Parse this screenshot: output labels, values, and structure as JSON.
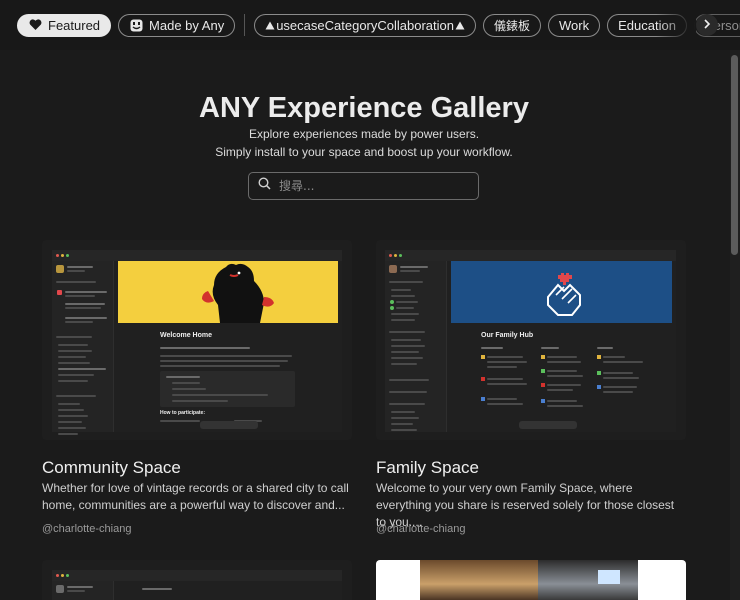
{
  "filters": [
    {
      "label": "Featured",
      "icon": "heart-icon",
      "active": true
    },
    {
      "label": "Made by Any",
      "icon": "any-logo-icon"
    },
    {
      "label": "usecaseCategoryCollaboration"
    },
    {
      "label": "儀錶板"
    },
    {
      "label": "Work"
    },
    {
      "label": "Education"
    },
    {
      "label": "Personal Grow"
    }
  ],
  "hero": {
    "title": "ANY Experience Gallery",
    "subtitle_1": "Explore experiences made by power users.",
    "subtitle_2": "Simply install to your space and boost up your workflow."
  },
  "search": {
    "placeholder": "搜尋..."
  },
  "cards": [
    {
      "title": "Community Space",
      "description": "Whether for love of vintage records or a shared city to call home, communities are a powerful way to discover and...",
      "author": "@charlotte-chiang",
      "preview_heading": "Welcome Home",
      "preview_subheading": "How to participate:",
      "banner_color": "#f4cf3e"
    },
    {
      "title": "Family Space",
      "description": "Welcome to your very own Family Space, where everything you share is reserved solely for those closest to you....",
      "author": "@charlotte-chiang",
      "preview_heading": "Our Family Hub",
      "banner_color": "#1d4f86"
    }
  ],
  "colors": {
    "background": "#1b1b1b",
    "chip_active_bg": "#e9e9e9",
    "heart": "#e2474b"
  }
}
